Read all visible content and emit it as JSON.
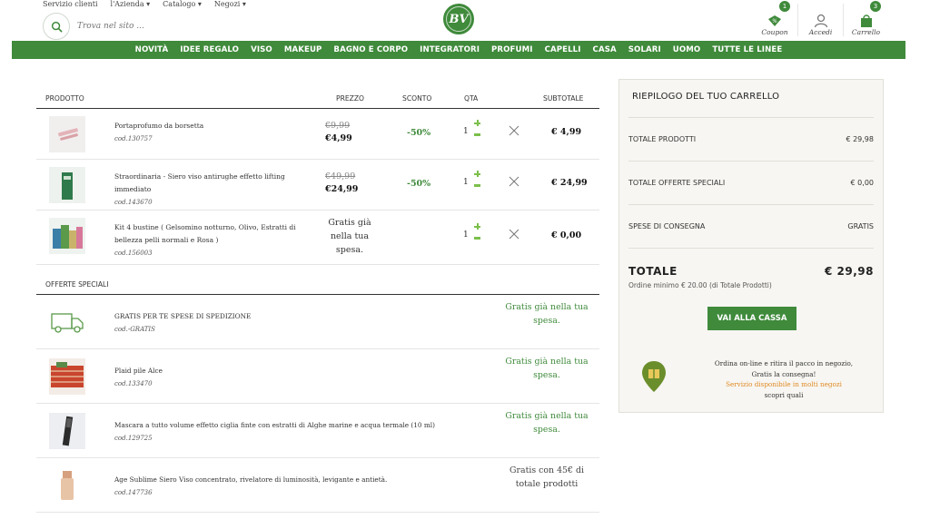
{
  "header": {
    "top_links": [
      "Servizio clienti",
      "l'Azienda ▾",
      "Catalogo ▾",
      "Negozi ▾"
    ],
    "search_placeholder": "Trova nel sito ...",
    "logo_text": "BV",
    "coupon": {
      "label": "Coupon",
      "badge": "1"
    },
    "account": {
      "label": "Accedi"
    },
    "cart": {
      "label": "Carrello",
      "badge": "3"
    }
  },
  "nav": [
    "NOVITÀ",
    "IDEE REGALO",
    "VISO",
    "MAKEUP",
    "BAGNO E CORPO",
    "INTEGRATORI",
    "PROFUMI",
    "CAPELLI",
    "CASA",
    "SOLARI",
    "UOMO",
    "TUTTE LE LINEE"
  ],
  "cart_table": {
    "headers": {
      "product": "PRODOTTO",
      "price": "PREZZO",
      "discount": "SCONTO",
      "qty": "QTA",
      "subtotal": "SUBTOTALE"
    },
    "rows": [
      {
        "name": "Portaprofumo da borsetta",
        "code": "cod.130757",
        "old_price": "€9,99",
        "new_price": "€4,99",
        "discount": "-50%",
        "qty": "1",
        "subtotal": "€ 4,99"
      },
      {
        "name": "Straordinaria - Siero viso antirughe effetto lifting immediato",
        "code": "cod.143670",
        "old_price": "€49,99",
        "new_price": "€24,99",
        "discount": "-50%",
        "qty": "1",
        "subtotal": "€ 24,99"
      },
      {
        "name": "Kit 4 bustine ( Gelsomino notturno, Olivo, Estratti di bellezza pelli normali e Rosa )",
        "code": "cod.156003",
        "free_price": "Gratis già nella tua spesa.",
        "qty": "1",
        "subtotal": "€ 0,00"
      }
    ]
  },
  "offers": {
    "title": "OFFERTE SPECIALI",
    "rows": [
      {
        "name": "GRATIS PER TE SPESE DI SPEDIZIONE",
        "code": "cod.-GRATIS",
        "status": "Gratis già nella tua spesa."
      },
      {
        "name": "Plaid pile Alce",
        "code": "cod.133470",
        "status": "Gratis già nella tua spesa."
      },
      {
        "name": "Mascara a tutto volume effetto ciglia finte con estratti di Alghe marine e acqua termale (10 ml)",
        "code": "cod.129725",
        "status": "Gratis già nella tua spesa."
      },
      {
        "name": "Age Sublime Siero Viso concentrato, rivelatore di luminosità, levigante e antietà.",
        "code": "cod.147736",
        "status": "Gratis con 45€ di totale prodotti"
      }
    ]
  },
  "summary": {
    "title": "RIEPILOGO DEL TUO CARRELLO",
    "total_products_label": "TOTALE PRODOTTI",
    "total_products": "€ 29,98",
    "special_offers_label": "TOTALE OFFERTE SPECIALI",
    "special_offers": "€ 0,00",
    "shipping_label": "SPESE DI CONSEGNA",
    "shipping": "GRATIS",
    "total_label": "TOTALE",
    "total": "€ 29,98",
    "minimum": "Ordine minimo € 20.00 (di Totale Prodotti)",
    "checkout": "VAI ALLA CASSA",
    "pickup_line1": "Ordina on-line e ritira il pacco in negozio,",
    "pickup_line2": "Gratis la consegna!",
    "pickup_line3": "Servizio disponibile in molti negozi",
    "pickup_line4": "scopri quali"
  },
  "colors": {
    "brand_green": "#3f8a3b",
    "accent_orange": "#e08a25"
  }
}
